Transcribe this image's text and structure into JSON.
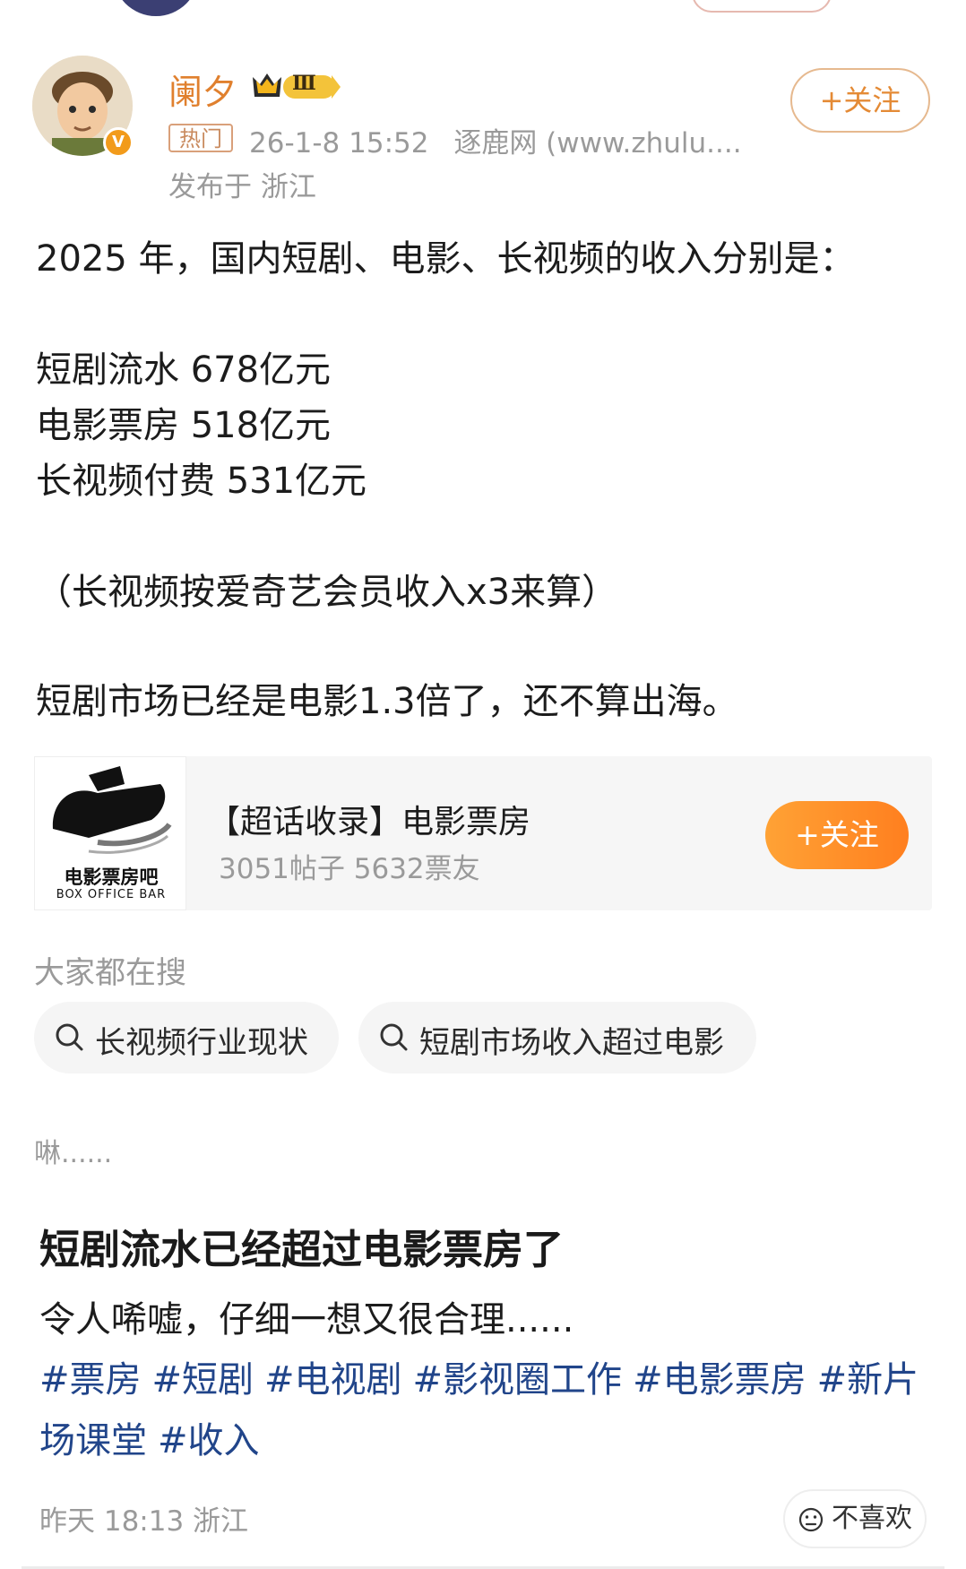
{
  "post": {
    "author": "阑夕",
    "level_badge": "Ⅲ",
    "hot_tag": "热门",
    "time": "26-1-8 15:52",
    "source": "逐鹿网 (www.zhulu....",
    "location": "发布于 浙江",
    "follow_label": "+关注",
    "verified_mark": "V",
    "body": {
      "line1": "2025 年，国内短剧、电影、长视频的收入分别是：",
      "line2": "短剧流水 678亿元",
      "line3": "电影票房 518亿元",
      "line4": "长视频付费 531亿元",
      "line5": "（长视频按爱奇艺会员收入x3来算）",
      "line6": "短剧市场已经是电影1.3倍了，还不算出海。"
    }
  },
  "topic_card": {
    "logo_text_cn": "电影票房吧",
    "logo_text_en": "BOX OFFICE BAR",
    "title": "【超话收录】电影票房",
    "stats": "3051帖子 5632票友",
    "follow_label": "+关注"
  },
  "search": {
    "label": "大家都在搜",
    "items": [
      "长视频行业现状",
      "短剧市场收入超过电影"
    ]
  },
  "comment_snippet": "啉......",
  "related": {
    "headline": "短剧流水已经超过电影票房了",
    "subline": "令人唏嘘，仔细一想又很合理......",
    "tags": [
      "#票房",
      "#短剧",
      "#电视剧",
      "#影视圈工作",
      "#电影票房",
      "#新片场课堂",
      "#收入"
    ],
    "time": "昨天 18:13 浙江",
    "dislike_label": "不喜欢"
  },
  "colors": {
    "accent_orange": "#e48a35",
    "follow_gradient_start": "#ffa235",
    "follow_gradient_end": "#ff7f1f",
    "tag_blue": "#21458a",
    "muted": "#9a9a9a"
  }
}
